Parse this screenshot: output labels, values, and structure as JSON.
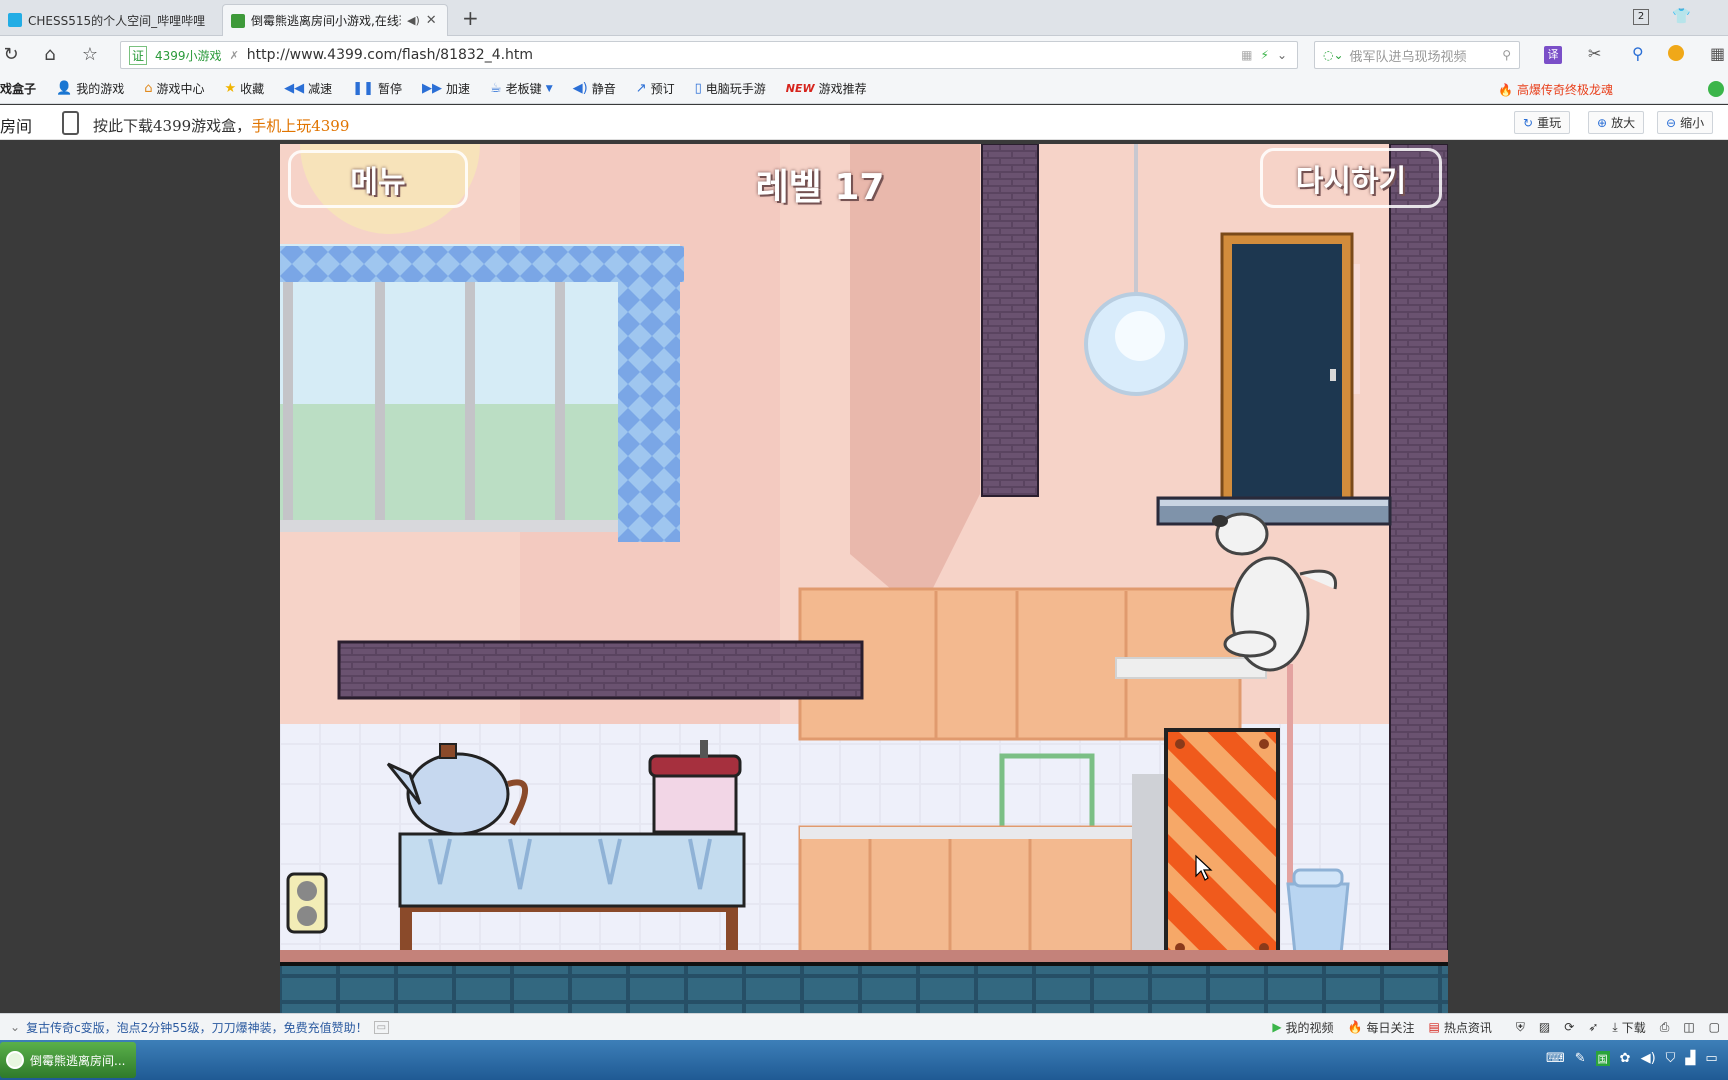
{
  "browser": {
    "tabs": [
      {
        "title": "CHESS515的个人空间_哔哩哔哩",
        "active": false
      },
      {
        "title": "倒霉熊逃离房间小游戏,在线玩",
        "active": true
      }
    ],
    "tab_count_badge": "2",
    "url_security_label": "4399小游戏",
    "url": "http://www.4399.com/flash/81832_4.htm",
    "search_placeholder": "俄军队进乌现场视频",
    "translate_label": "译"
  },
  "bookmarks": [
    {
      "label": "戏盒子",
      "icon": "box-icon"
    },
    {
      "label": "我的游戏",
      "icon": "user-icon"
    },
    {
      "label": "游戏中心",
      "icon": "home-icon"
    },
    {
      "label": "收藏",
      "icon": "star-icon"
    },
    {
      "label": "减速",
      "icon": "rewind-icon"
    },
    {
      "label": "暂停",
      "icon": "pause-icon"
    },
    {
      "label": "加速",
      "icon": "fast-forward-icon"
    },
    {
      "label": "老板键",
      "icon": "cup-icon"
    },
    {
      "label": "静音",
      "icon": "speaker-icon"
    },
    {
      "label": "预订",
      "icon": "share-icon"
    },
    {
      "label": "电脑玩手游",
      "icon": "phone-icon"
    },
    {
      "label": "游戏推荐",
      "icon": "new-badge",
      "badge": "NEW"
    }
  ],
  "bookmark_promo": "高爆传奇终极龙魂",
  "pagebar": {
    "left_label": "房间",
    "download_text": "按此下载4399游戏盒，",
    "download_highlight": "手机上玩4399",
    "buttons": [
      "重玩",
      "放大",
      "缩小"
    ]
  },
  "game": {
    "menu_label": "메뉴",
    "level_label": "레벨 17",
    "retry_label": "다시하기"
  },
  "statusbar": {
    "ad_text": "复古传奇c变版，泡点2分钟55级，刀刀爆神装，免费充值赞助！",
    "items": [
      "我的视频",
      "每日关注",
      "热点资讯",
      "下载"
    ]
  },
  "taskbar": {
    "start_label": "倒霉熊逃离房间...",
    "tray_label": "国"
  },
  "colors": {
    "brick": "#5a4460",
    "hazard_orange": "#f05a1c",
    "floor_tile": "#2e5a72",
    "door": "#1d3750"
  }
}
